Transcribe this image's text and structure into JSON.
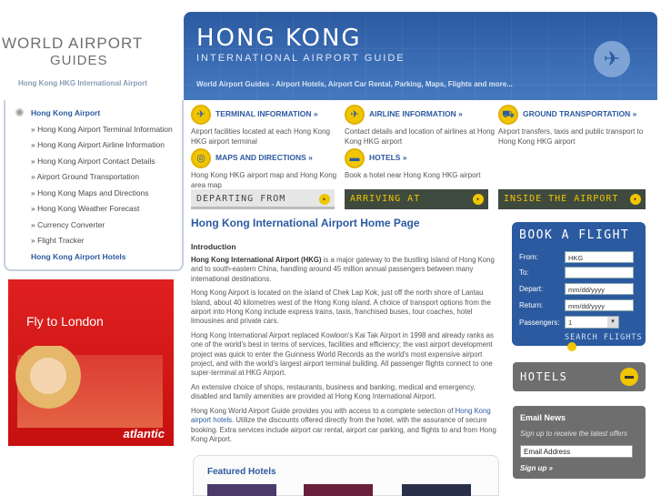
{
  "logo": {
    "line1": "WORLD AIRPORT",
    "line2": "GUIDES"
  },
  "tagline": "Hong Kong HKG International Airport",
  "banner": {
    "title": "HONG KONG",
    "subtitle": "INTERNATIONAL AIRPORT GUIDE",
    "links": "World Airport Guides - Airport Hotels, Airport Car Rental, Parking, Maps, Flights and more..."
  },
  "sidenav": {
    "items": [
      {
        "label": "Hong Kong Airport",
        "main": true
      },
      {
        "label": "» Hong Kong Airport Terminal Information"
      },
      {
        "label": "» Hong Kong Airport Airline Information"
      },
      {
        "label": "» Hong Kong Airport Contact Details"
      },
      {
        "label": "» Airport Ground Transportation"
      },
      {
        "label": "» Hong Kong Maps and Directions"
      },
      {
        "label": "» Hong Kong Weather Forecast"
      },
      {
        "label": "» Currency Converter"
      },
      {
        "label": "» Flight Tracker"
      },
      {
        "label": "Hong Kong Airport Hotels",
        "main": true
      }
    ]
  },
  "ad": {
    "headline": "Fly to London",
    "brand": "atlantic"
  },
  "quick": [
    {
      "title": "TERMINAL INFORMATION »",
      "desc": "Airport facilities located at each Hong Kong HKG airport terminal",
      "icon": "✈"
    },
    {
      "title": "AIRLINE INFORMATION »",
      "desc": "Contact details and location of airlines at Hong Kong HKG airport",
      "icon": "✈"
    },
    {
      "title": "GROUND TRANSPORTATION »",
      "desc": "Airport transfers, taxis and public transport to Hong Kong HKG airport",
      "icon": "⛟"
    },
    {
      "title": "MAPS AND DIRECTIONS »",
      "desc": "Hong Kong HKG airport map and Hong Kong area map",
      "icon": "◎"
    },
    {
      "title": "HOTELS »",
      "desc": "Book a hotel near Hong Kong HKG airport",
      "icon": "▬"
    }
  ],
  "tabs": [
    "DEPARTING FROM",
    "ARRIVING AT",
    "INSIDE THE AIRPORT"
  ],
  "content": {
    "heading": "Hong Kong International Airport Home Page",
    "intro_heading": "Introduction",
    "p1_bold": "Hong Kong International Airport (HKG)",
    "p1": " is a major gateway to the bustling island of Hong Kong and to south-eastern China, handling around 45 million annual passengers between many international destinations.",
    "p2": "Hong Kong Airport is located on the island of Chek Lap Kok, just off the north shore of Lantau Island, about 40 kilometres west of the Hong Kong island. A choice of transport options from the airport into Hong Kong include express trains, taxis, franchised buses, tour coaches, hotel limousines and private cars.",
    "p3": "Hong Kong International Airport replaced Kowloon's Kai Tak Airport in 1998 and already ranks as one of the world's best in terms of services, facilities and efficiency; the vast airport development project was quick to enter the Guinness World Records as the world's most expensive airport project, and with the world's largest airport terminal building. All passenger flights connect to one super-terminal at HKG Airport.",
    "p4": "An extensive choice of shops, restaurants, business and banking, medical and emergency, disabled and family amenities are provided at Hong Kong International Airport.",
    "p5a": "Hong Kong World Airport Guide provides you with access to a complete selection of ",
    "p5link": "Hong Kong airport hotels",
    "p5b": ". Utilize the discounts offered directly from the hotel, with the assurance of secure booking. Extra services include airport car rental, airport car parking, and flights to and from Hong Kong Airport."
  },
  "featured": {
    "title": "Featured Hotels"
  },
  "booking": {
    "title": "BOOK A FLIGHT",
    "from_label": "From:",
    "from_value": "HKG",
    "to_label": "To:",
    "to_value": "",
    "depart_label": "Depart:",
    "depart_value": "mm/dd/yyyy",
    "return_label": "Return:",
    "return_value": "mm/dd/yyyy",
    "passengers_label": "Passengers:",
    "passengers_value": "1",
    "search": "SEARCH FLIGHTS"
  },
  "hotels_box": {
    "title": "HOTELS"
  },
  "email": {
    "title": "Email News",
    "desc": "Sign up to receive the latest offers",
    "placeholder": "Email Address",
    "signup": "Sign up »"
  },
  "colors": {
    "brand_blue": "#2c5aa0",
    "accent_yellow": "#f1c500"
  }
}
